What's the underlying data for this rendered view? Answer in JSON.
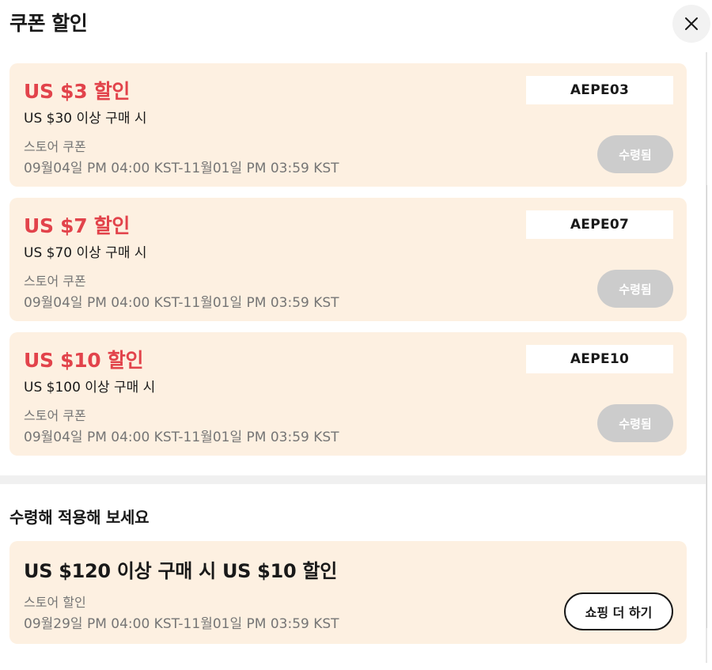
{
  "header": {
    "title": "쿠폰 할인",
    "close_icon": "close-icon"
  },
  "coupons": [
    {
      "amount": "US $3 할인",
      "condition": "US $30 이상 구매 시",
      "type": "스토어 쿠폰",
      "period": "09월04일 PM 04:00 KST-11월01일 PM 03:59 KST",
      "code": "AEPE03",
      "status": "수령됨"
    },
    {
      "amount": "US $7 할인",
      "condition": "US $70 이상 구매 시",
      "type": "스토어 쿠폰",
      "period": "09월04일 PM 04:00 KST-11월01일 PM 03:59 KST",
      "code": "AEPE07",
      "status": "수령됨"
    },
    {
      "amount": "US $10 할인",
      "condition": "US $100 이상 구매 시",
      "type": "스토어 쿠폰",
      "period": "09월04일 PM 04:00 KST-11월01일 PM 03:59 KST",
      "code": "AEPE10",
      "status": "수령됨"
    }
  ],
  "promo_section": {
    "title": "수령해 적용해 보세요",
    "promo": {
      "title": "US $120 이상 구매 시 US $10 할인",
      "type": "스토어 할인",
      "period": "09월29일 PM 04:00 KST-11월01일 PM 03:59 KST",
      "button_label": "쇼핑 더 하기"
    }
  },
  "colors": {
    "discount_red": "#e2434b",
    "card_background": "#fdf0e1",
    "received_button": "#cccccc",
    "muted_text": "#757575"
  }
}
